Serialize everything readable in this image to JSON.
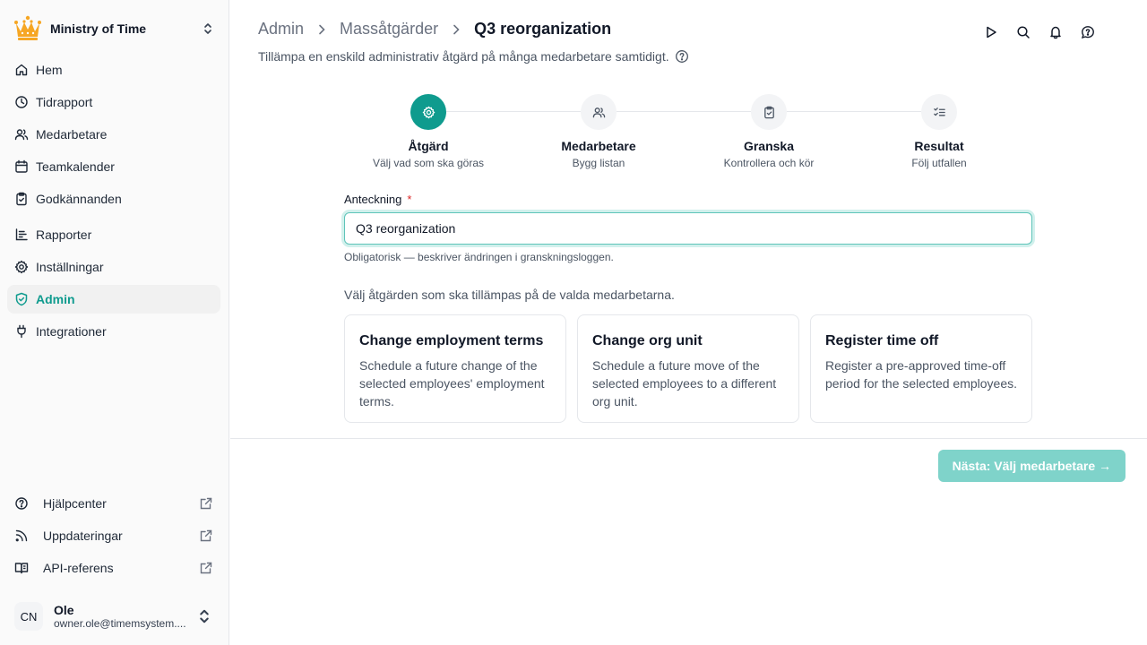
{
  "org": {
    "name": "Ministry of Time",
    "logo_icon": "crown-logo",
    "accent": "#f6a623"
  },
  "sidebar": {
    "items": [
      {
        "label": "Hem",
        "icon": "home-icon"
      },
      {
        "label": "Tidrapport",
        "icon": "clock-icon"
      },
      {
        "label": "Medarbetare",
        "icon": "users-icon"
      },
      {
        "label": "Teamkalender",
        "icon": "calendar-icon"
      },
      {
        "label": "Godkännanden",
        "icon": "clipboard-check-icon"
      },
      {
        "label": "Rapporter",
        "icon": "chart-icon"
      },
      {
        "label": "Inställningar",
        "icon": "gear-icon"
      },
      {
        "label": "Admin",
        "icon": "shield-check-icon",
        "active": true
      },
      {
        "label": "Integrationer",
        "icon": "plug-icon"
      }
    ],
    "bottom_items": [
      {
        "label": "Hjälpcenter",
        "icon": "help-circle-icon"
      },
      {
        "label": "Uppdateringar",
        "icon": "rss-icon"
      },
      {
        "label": "API-referens",
        "icon": "book-icon"
      }
    ]
  },
  "user": {
    "initials": "CN",
    "name": "Ole",
    "email": "owner.ole@timemsystem...."
  },
  "header": {
    "breadcrumb": [
      "Admin",
      "Massåtgärder",
      "Q3 reorganization"
    ],
    "subtitle": "Tillämpa en enskild administrativ åtgärd på många medarbetare samtidigt."
  },
  "stepper": [
    {
      "title": "Åtgärd",
      "desc": "Välj vad som ska göras",
      "icon": "gear-icon",
      "active": true
    },
    {
      "title": "Medarbetare",
      "desc": "Bygg listan",
      "icon": "users-icon"
    },
    {
      "title": "Granska",
      "desc": "Kontrollera och kör",
      "icon": "clipboard-check-icon"
    },
    {
      "title": "Resultat",
      "desc": "Följ utfallen",
      "icon": "list-checks-icon"
    }
  ],
  "form": {
    "note_label": "Anteckning",
    "required_mark": "*",
    "note_value": "Q3 reorganization",
    "note_hint": "Obligatorisk — beskriver ändringen i granskningsloggen.",
    "choose_text": "Välj åtgärden som ska tillämpas på de valda medarbetarna."
  },
  "actions": [
    {
      "title": "Change employment terms",
      "desc": "Schedule a future change of the selected employees' employment terms."
    },
    {
      "title": "Change org unit",
      "desc": "Schedule a future move of the selected employees to a different org unit."
    },
    {
      "title": "Register time off",
      "desc": "Register a pre-approved time-off period for the selected employees."
    }
  ],
  "footer": {
    "next_label": "Nästa: Välj medarbetare →"
  },
  "colors": {
    "accent": "#0f9b8e",
    "button_disabled": "#7fd3ca"
  }
}
